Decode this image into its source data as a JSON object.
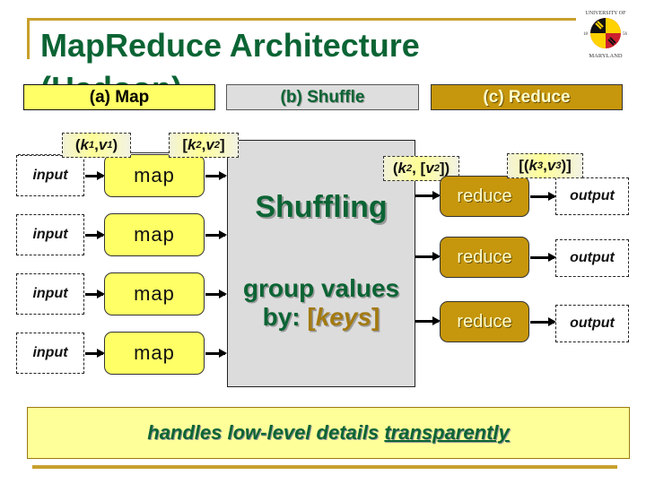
{
  "slide": {
    "title": "MapReduce Architecture",
    "subtitle_obscured": "(Hadoop)",
    "stages": {
      "map": "(a) Map",
      "shuffle": "(b) Shuffle",
      "reduce": "(c) Reduce"
    },
    "colors": {
      "title_green": "#0b6434",
      "gold": "#c8a02c",
      "map_yellow": "#ffff66",
      "shuffle_gray": "#dcdcdc",
      "reduce_gold": "#c6960c",
      "footer_yellow": "#ffff99"
    }
  },
  "map_phase": {
    "inputs": [
      "input",
      "input",
      "input",
      "input"
    ],
    "mappers": [
      "map",
      "map",
      "map",
      "map"
    ],
    "input_pair": {
      "open": "(",
      "k": "k",
      "k_sub": "1",
      "sep": ", ",
      "v": "v",
      "v_sub": "1",
      "close": ")"
    },
    "output_pair": {
      "open": "[",
      "k": "k",
      "k_sub": "2",
      "sep": ", ",
      "v": "v",
      "v_sub": "2",
      "close": "]"
    }
  },
  "shuffle_phase": {
    "label": "Shuffling",
    "group_line1": "group values",
    "group_prefix": "by: ",
    "keys_open": "[",
    "keys_word": "keys",
    "keys_close": "]"
  },
  "reduce_phase": {
    "input_pair": {
      "open": "(",
      "k": "k",
      "k_sub": "2",
      "sep": ", [",
      "v": "v",
      "v_sub": "2",
      "close": "])"
    },
    "output_pair": {
      "open": "[(",
      "k": "k",
      "k_sub": "3",
      "sep": ", ",
      "v": "v",
      "v_sub": "3",
      "close": ")]"
    },
    "reducers": [
      "reduce",
      "reduce",
      "reduce"
    ],
    "outputs": [
      "output",
      "output",
      "output"
    ]
  },
  "footer": {
    "text": "handles low-level details ",
    "emphasis": "transparently"
  },
  "logo": {
    "top_text": "UNIVERSITY OF",
    "bottom_text": "MARYLAND",
    "year_left": "18",
    "year_right": "56"
  }
}
